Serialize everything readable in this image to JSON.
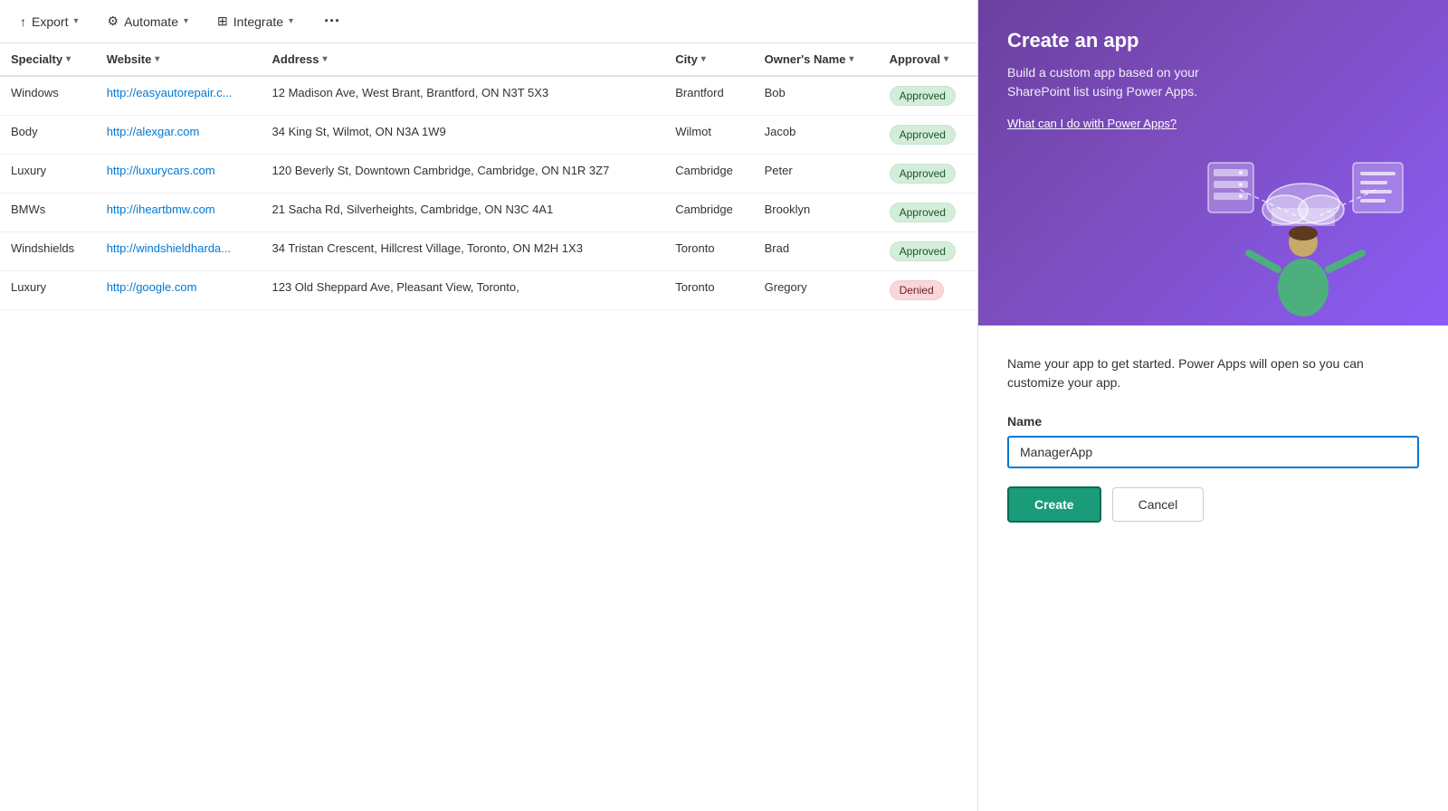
{
  "toolbar": {
    "export_label": "Export",
    "automate_label": "Automate",
    "integrate_label": "Integrate"
  },
  "table": {
    "columns": [
      {
        "key": "specialty",
        "label": "Specialty"
      },
      {
        "key": "website",
        "label": "Website"
      },
      {
        "key": "address",
        "label": "Address"
      },
      {
        "key": "city",
        "label": "City"
      },
      {
        "key": "owners_name",
        "label": "Owner's Name"
      },
      {
        "key": "approval",
        "label": "Approval"
      }
    ],
    "rows": [
      {
        "specialty": "Windows",
        "website": "http://easyautorepair.c...",
        "address": "12 Madison Ave, West Brant, Brantford, ON N3T 5X3",
        "city": "Brantford",
        "owners_name": "Bob",
        "approval": "Approved",
        "approval_type": "approved"
      },
      {
        "specialty": "Body",
        "website": "http://alexgar.com",
        "address": "34 King St, Wilmot, ON N3A 1W9",
        "city": "Wilmot",
        "owners_name": "Jacob",
        "approval": "Approved",
        "approval_type": "approved"
      },
      {
        "specialty": "Luxury",
        "website": "http://luxurycars.com",
        "address": "120 Beverly St, Downtown Cambridge, Cambridge, ON N1R 3Z7",
        "city": "Cambridge",
        "owners_name": "Peter",
        "approval": "Approved",
        "approval_type": "approved"
      },
      {
        "specialty": "BMWs",
        "website": "http://iheartbmw.com",
        "address": "21 Sacha Rd, Silverheights, Cambridge, ON N3C 4A1",
        "city": "Cambridge",
        "owners_name": "Brooklyn",
        "approval": "Approved",
        "approval_type": "approved"
      },
      {
        "specialty": "Windshields",
        "website": "http://windshieldharda...",
        "address": "34 Tristan Crescent, Hillcrest Village, Toronto, ON M2H 1X3",
        "city": "Toronto",
        "owners_name": "Brad",
        "approval": "Approved",
        "approval_type": "approved"
      },
      {
        "specialty": "Luxury",
        "website": "http://google.com",
        "address": "123 Old Sheppard Ave, Pleasant View, Toronto,",
        "city": "Toronto",
        "owners_name": "Gregory",
        "approval": "Denied",
        "approval_type": "denied"
      }
    ]
  },
  "panel": {
    "title": "Create an app",
    "description": "Build a custom app based on your SharePoint list using Power Apps.",
    "link_text": "What can I do with Power Apps?",
    "body_text": "Name your app to get started. Power Apps will open so you can customize your app.",
    "name_label": "Name",
    "name_input_value": "ManagerApp",
    "create_button": "Create",
    "cancel_button": "Cancel"
  },
  "colors": {
    "approved_bg": "#d4edda",
    "approved_text": "#155724",
    "denied_bg": "#f8d7da",
    "denied_text": "#721c24",
    "link_color": "#0078d4",
    "create_btn": "#1a9c7a",
    "panel_purple": "#7c4dbc"
  }
}
